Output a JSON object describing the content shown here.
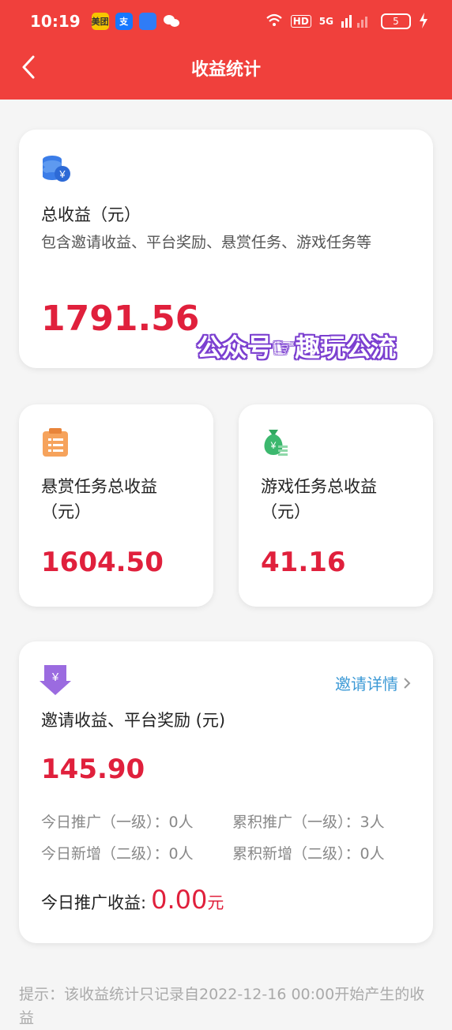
{
  "status_bar": {
    "time": "10:19",
    "apps": [
      "美团",
      "支",
      "",
      ""
    ],
    "network": "5G",
    "hd": "HD",
    "battery": "5"
  },
  "nav": {
    "title": "收益统计"
  },
  "total_card": {
    "label": "总收益（元）",
    "desc": "包含邀请收益、平台奖励、悬赏任务、游戏任务等",
    "amount": "1791.56"
  },
  "watermark": "公众号☞趣玩公流",
  "reward_card": {
    "label": "悬赏任务总收益（元）",
    "amount": "1604.50"
  },
  "game_card": {
    "label": "游戏任务总收益（元）",
    "amount": "41.16"
  },
  "invite_card": {
    "link": "邀请详情",
    "label": "邀请收益、平台奖励 (元)",
    "amount": "145.90",
    "stats": [
      "今日推广（一级）：0人",
      "累积推广（一级）：3人",
      "今日新增（二级）：0人",
      "累积新增（二级）：0人"
    ],
    "today_label": "今日推广收益:",
    "today_value": "0.00",
    "today_unit": "元"
  },
  "tip": "提示：该收益统计只记录自2022-12-16 00:00开始产生的收益",
  "colors": {
    "header": "#f0403c",
    "amount": "#e0203c",
    "link": "#3d9ad6"
  }
}
